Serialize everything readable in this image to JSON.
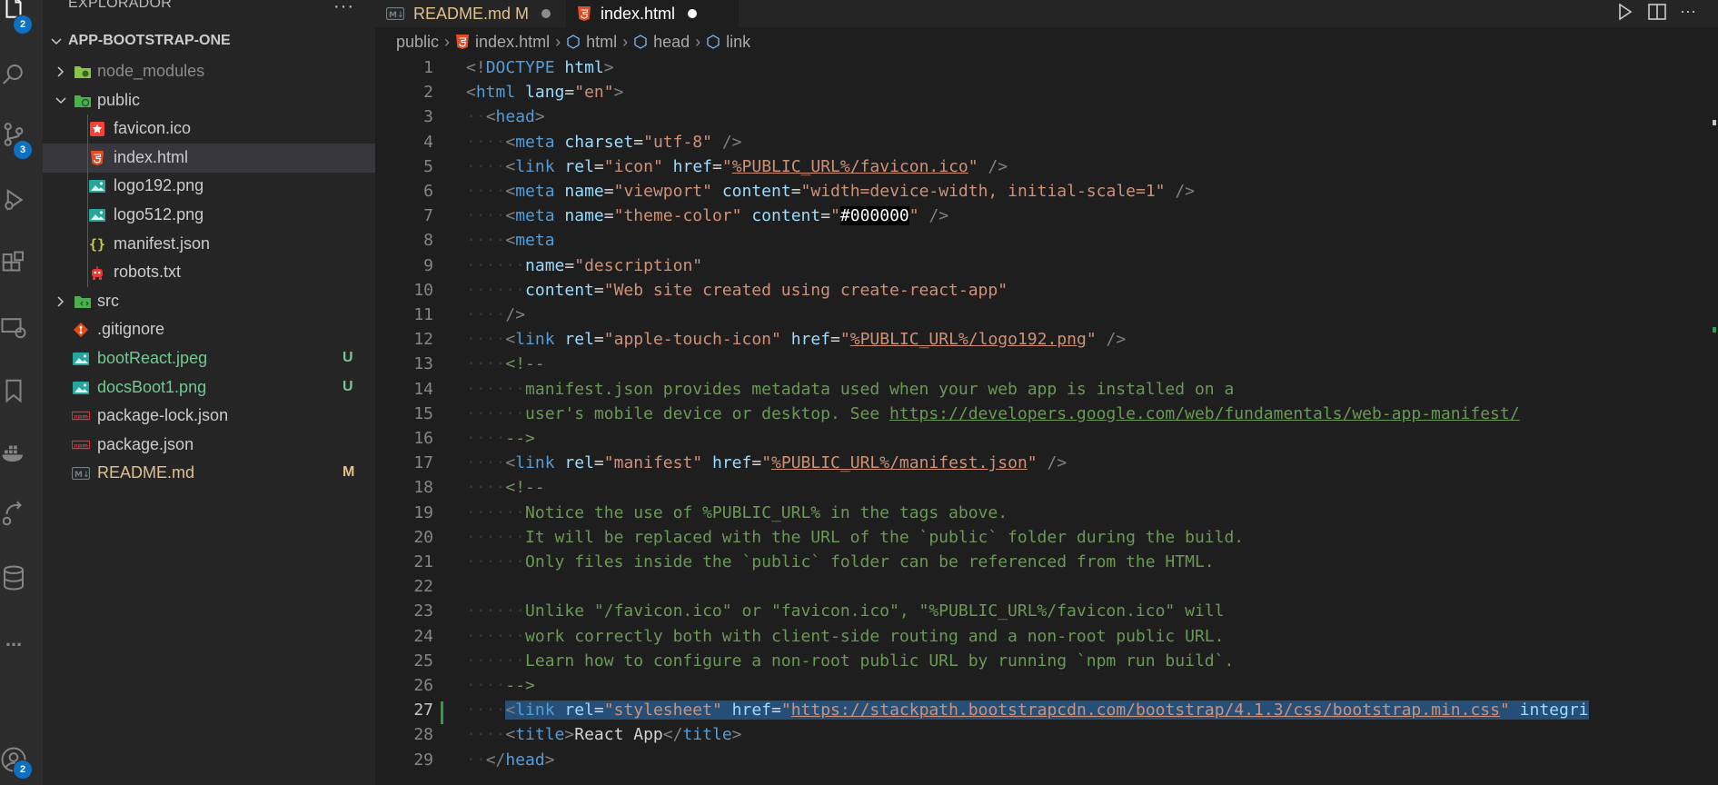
{
  "activity_bar": {
    "explorer_badge": "2",
    "scm_badge": "3",
    "accounts_badge": "2",
    "more_label": "..."
  },
  "sidebar": {
    "title": "EXPLORADOR",
    "more_actions": "···",
    "root_folder": "APP-BOOTSTRAP-ONE",
    "items": [
      {
        "name": "node_modules",
        "type": "folder-node",
        "indent": 0,
        "collapsed": true,
        "color": "#8b8b8b"
      },
      {
        "name": "public",
        "type": "folder-public",
        "indent": 0,
        "expanded": true,
        "color": "#cccccc"
      },
      {
        "name": "favicon.ico",
        "type": "favicon",
        "indent": 1,
        "color": "#cccccc"
      },
      {
        "name": "index.html",
        "type": "html",
        "indent": 1,
        "selected": true,
        "color": "#cccccc"
      },
      {
        "name": "logo192.png",
        "type": "image",
        "indent": 1,
        "color": "#cccccc"
      },
      {
        "name": "logo512.png",
        "type": "image",
        "indent": 1,
        "color": "#cccccc"
      },
      {
        "name": "manifest.json",
        "type": "json",
        "indent": 1,
        "color": "#cccccc"
      },
      {
        "name": "robots.txt",
        "type": "robot",
        "indent": 1,
        "color": "#cccccc"
      },
      {
        "name": "src",
        "type": "folder-src",
        "indent": 0,
        "collapsed": true,
        "color": "#cccccc"
      },
      {
        "name": ".gitignore",
        "type": "git",
        "indent": 0,
        "color": "#cccccc"
      },
      {
        "name": "bootReact.jpeg",
        "type": "image",
        "indent": 0,
        "status": "U",
        "color": "#73c991"
      },
      {
        "name": "docsBoot1.png",
        "type": "image",
        "indent": 0,
        "status": "U",
        "color": "#73c991"
      },
      {
        "name": "package-lock.json",
        "type": "npm",
        "indent": 0,
        "color": "#cccccc"
      },
      {
        "name": "package.json",
        "type": "npm",
        "indent": 0,
        "color": "#cccccc"
      },
      {
        "name": "README.md",
        "type": "markdown",
        "indent": 0,
        "status": "M",
        "color": "#e2c08d"
      }
    ]
  },
  "tabs": [
    {
      "label": "README.md M",
      "color": "#e2c08d",
      "active": false
    },
    {
      "label": "index.html",
      "color": "#ffffff",
      "active": true
    }
  ],
  "breadcrumb": {
    "folder": "public",
    "file": "index.html",
    "symbols": [
      "html",
      "head",
      "link"
    ]
  },
  "editor": {
    "active_line": 27,
    "lines": [
      {
        "n": "1",
        "indent": 0,
        "tokens": [
          [
            "p",
            "<!"
          ],
          [
            "tag",
            "DOCTYPE"
          ],
          [
            "t",
            " "
          ],
          [
            "attr",
            "html"
          ],
          [
            "p",
            ">"
          ]
        ]
      },
      {
        "n": "2",
        "indent": 0,
        "tokens": [
          [
            "p",
            "<"
          ],
          [
            "tag",
            "html"
          ],
          [
            "t",
            " "
          ],
          [
            "attr",
            "lang"
          ],
          [
            "t",
            "="
          ],
          [
            "str",
            "\"en\""
          ],
          [
            "p",
            ">"
          ]
        ]
      },
      {
        "n": "3",
        "indent": 1,
        "tokens": [
          [
            "p",
            "<"
          ],
          [
            "tag",
            "head"
          ],
          [
            "p",
            ">"
          ]
        ]
      },
      {
        "n": "4",
        "indent": 2,
        "tokens": [
          [
            "p",
            "<"
          ],
          [
            "tag",
            "meta"
          ],
          [
            "t",
            " "
          ],
          [
            "attr",
            "charset"
          ],
          [
            "t",
            "="
          ],
          [
            "str",
            "\"utf-8\""
          ],
          [
            "t",
            " "
          ],
          [
            "p",
            "/>"
          ]
        ]
      },
      {
        "n": "5",
        "indent": 2,
        "tokens": [
          [
            "p",
            "<"
          ],
          [
            "tag",
            "link"
          ],
          [
            "t",
            " "
          ],
          [
            "attr",
            "rel"
          ],
          [
            "t",
            "="
          ],
          [
            "str",
            "\"icon\""
          ],
          [
            "t",
            " "
          ],
          [
            "attr",
            "href"
          ],
          [
            "t",
            "="
          ],
          [
            "str",
            "\""
          ],
          [
            "strlink",
            "%PUBLIC_URL%/favicon.ico"
          ],
          [
            "str",
            "\""
          ],
          [
            "t",
            " "
          ],
          [
            "p",
            "/>"
          ]
        ]
      },
      {
        "n": "6",
        "indent": 2,
        "tokens": [
          [
            "p",
            "<"
          ],
          [
            "tag",
            "meta"
          ],
          [
            "t",
            " "
          ],
          [
            "attr",
            "name"
          ],
          [
            "t",
            "="
          ],
          [
            "str",
            "\"viewport\""
          ],
          [
            "t",
            " "
          ],
          [
            "attr",
            "content"
          ],
          [
            "t",
            "="
          ],
          [
            "str",
            "\"width=device-width, initial-scale=1\""
          ],
          [
            "t",
            " "
          ],
          [
            "p",
            "/>"
          ]
        ]
      },
      {
        "n": "7",
        "indent": 2,
        "tokens": [
          [
            "p",
            "<"
          ],
          [
            "tag",
            "meta"
          ],
          [
            "t",
            " "
          ],
          [
            "attr",
            "name"
          ],
          [
            "t",
            "="
          ],
          [
            "str",
            "\"theme-color\""
          ],
          [
            "t",
            " "
          ],
          [
            "attr",
            "content"
          ],
          [
            "t",
            "="
          ],
          [
            "str",
            "\""
          ],
          [
            "hex",
            "#000000"
          ],
          [
            "str",
            "\""
          ],
          [
            "t",
            " "
          ],
          [
            "p",
            "/>"
          ]
        ]
      },
      {
        "n": "8",
        "indent": 2,
        "tokens": [
          [
            "p",
            "<"
          ],
          [
            "tag",
            "meta"
          ]
        ]
      },
      {
        "n": "9",
        "indent": 3,
        "tokens": [
          [
            "attr",
            "name"
          ],
          [
            "t",
            "="
          ],
          [
            "str",
            "\"description\""
          ]
        ]
      },
      {
        "n": "10",
        "indent": 3,
        "tokens": [
          [
            "attr",
            "content"
          ],
          [
            "t",
            "="
          ],
          [
            "str",
            "\"Web site created using create-react-app\""
          ]
        ]
      },
      {
        "n": "11",
        "indent": 2,
        "tokens": [
          [
            "p",
            "/>"
          ]
        ]
      },
      {
        "n": "12",
        "indent": 2,
        "tokens": [
          [
            "p",
            "<"
          ],
          [
            "tag",
            "link"
          ],
          [
            "t",
            " "
          ],
          [
            "attr",
            "rel"
          ],
          [
            "t",
            "="
          ],
          [
            "str",
            "\"apple-touch-icon\""
          ],
          [
            "t",
            " "
          ],
          [
            "attr",
            "href"
          ],
          [
            "t",
            "="
          ],
          [
            "str",
            "\""
          ],
          [
            "strlink",
            "%PUBLIC_URL%/logo192.png"
          ],
          [
            "str",
            "\""
          ],
          [
            "t",
            " "
          ],
          [
            "p",
            "/>"
          ]
        ]
      },
      {
        "n": "13",
        "indent": 2,
        "tokens": [
          [
            "com",
            "<!--"
          ]
        ]
      },
      {
        "n": "14",
        "indent": 3,
        "tokens": [
          [
            "com",
            "manifest.json provides metadata used when your web app is installed on a"
          ]
        ]
      },
      {
        "n": "15",
        "indent": 3,
        "tokens": [
          [
            "com",
            "user's mobile device or desktop. See "
          ],
          [
            "comlink",
            "https://developers.google.com/web/fundamentals/web-app-manifest/"
          ]
        ]
      },
      {
        "n": "16",
        "indent": 2,
        "tokens": [
          [
            "com",
            "-->"
          ]
        ]
      },
      {
        "n": "17",
        "indent": 2,
        "tokens": [
          [
            "p",
            "<"
          ],
          [
            "tag",
            "link"
          ],
          [
            "t",
            " "
          ],
          [
            "attr",
            "rel"
          ],
          [
            "t",
            "="
          ],
          [
            "str",
            "\"manifest\""
          ],
          [
            "t",
            " "
          ],
          [
            "attr",
            "href"
          ],
          [
            "t",
            "="
          ],
          [
            "str",
            "\""
          ],
          [
            "strlink",
            "%PUBLIC_URL%/manifest.json"
          ],
          [
            "str",
            "\""
          ],
          [
            "t",
            " "
          ],
          [
            "p",
            "/>"
          ]
        ]
      },
      {
        "n": "18",
        "indent": 2,
        "tokens": [
          [
            "com",
            "<!--"
          ]
        ]
      },
      {
        "n": "19",
        "indent": 3,
        "tokens": [
          [
            "com",
            "Notice the use of %PUBLIC_URL% in the tags above."
          ]
        ]
      },
      {
        "n": "20",
        "indent": 3,
        "tokens": [
          [
            "com",
            "It will be replaced with the URL of the `public` folder during the build."
          ]
        ]
      },
      {
        "n": "21",
        "indent": 3,
        "tokens": [
          [
            "com",
            "Only files inside the `public` folder can be referenced from the HTML."
          ]
        ]
      },
      {
        "n": "22",
        "indent": 0,
        "tokens": []
      },
      {
        "n": "23",
        "indent": 3,
        "tokens": [
          [
            "com",
            "Unlike \"/favicon.ico\" or \"favicon.ico\", \"%PUBLIC_URL%/favicon.ico\" will"
          ]
        ]
      },
      {
        "n": "24",
        "indent": 3,
        "tokens": [
          [
            "com",
            "work correctly both with client-side routing and a non-root public URL."
          ]
        ]
      },
      {
        "n": "25",
        "indent": 3,
        "tokens": [
          [
            "com",
            "Learn how to configure a non-root public URL by running `npm run build`."
          ]
        ]
      },
      {
        "n": "26",
        "indent": 2,
        "tokens": [
          [
            "com",
            "-->"
          ]
        ]
      },
      {
        "n": "27",
        "indent": 2,
        "selected": true,
        "tokens": [
          [
            "p",
            "<"
          ],
          [
            "tag",
            "link"
          ],
          [
            "t",
            " "
          ],
          [
            "attr",
            "rel"
          ],
          [
            "t",
            "="
          ],
          [
            "str",
            "\"stylesheet\""
          ],
          [
            "t",
            " "
          ],
          [
            "attr",
            "href"
          ],
          [
            "t",
            "="
          ],
          [
            "str",
            "\""
          ],
          [
            "strlink",
            "https://stackpath.bootstrapcdn.com/bootstrap/4.1.3/css/bootstrap.min.css"
          ],
          [
            "str",
            "\""
          ],
          [
            "t",
            " "
          ],
          [
            "attr",
            "integri"
          ]
        ]
      },
      {
        "n": "28",
        "indent": 2,
        "tokens": [
          [
            "p",
            "<"
          ],
          [
            "tag",
            "title"
          ],
          [
            "p",
            ">"
          ],
          [
            "t",
            "React App"
          ],
          [
            "p",
            "</"
          ],
          [
            "tag",
            "title"
          ],
          [
            "p",
            ">"
          ]
        ]
      },
      {
        "n": "29",
        "indent": 1,
        "tokens": [
          [
            "p",
            "</"
          ],
          [
            "tag",
            "head"
          ],
          [
            "p",
            ">"
          ]
        ]
      }
    ]
  }
}
